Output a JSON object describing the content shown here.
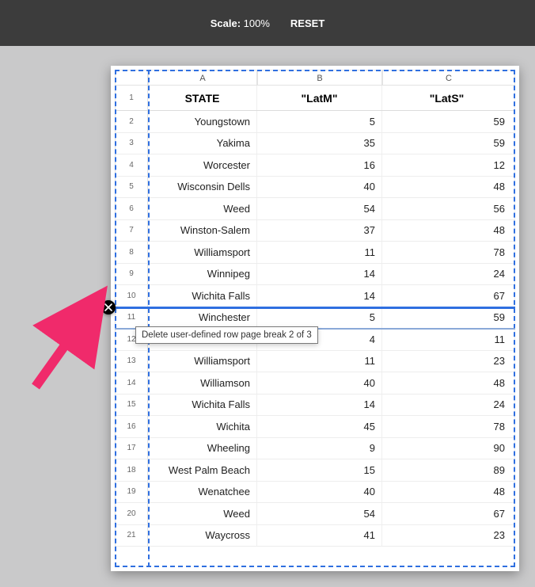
{
  "toolbar": {
    "scale_label": "Scale:",
    "scale_value": "100%",
    "reset": "RESET"
  },
  "columns": {
    "A": "A",
    "B": "B",
    "C": "C"
  },
  "header": {
    "state": "STATE",
    "latm": "\"LatM\"",
    "lats": "\"LatS\""
  },
  "rows": [
    {
      "n": "1"
    },
    {
      "n": "2",
      "state": "Youngstown",
      "latm": "5",
      "lats": "59"
    },
    {
      "n": "3",
      "state": "Yakima",
      "latm": "35",
      "lats": "59"
    },
    {
      "n": "4",
      "state": "Worcester",
      "latm": "16",
      "lats": "12"
    },
    {
      "n": "5",
      "state": "Wisconsin Dells",
      "latm": "40",
      "lats": "48"
    },
    {
      "n": "6",
      "state": "Weed",
      "latm": "54",
      "lats": "56"
    },
    {
      "n": "7",
      "state": "Winston-Salem",
      "latm": "37",
      "lats": "48"
    },
    {
      "n": "8",
      "state": "Williamsport",
      "latm": "11",
      "lats": "78"
    },
    {
      "n": "9",
      "state": "Winnipeg",
      "latm": "14",
      "lats": "24"
    },
    {
      "n": "10",
      "state": "Wichita Falls",
      "latm": "14",
      "lats": "67"
    },
    {
      "n": "11",
      "state": "Winchester",
      "latm": "5",
      "lats": "59"
    },
    {
      "n": "12",
      "state": "",
      "latm": "4",
      "lats": "11"
    },
    {
      "n": "13",
      "state": "Williamsport",
      "latm": "11",
      "lats": "23"
    },
    {
      "n": "14",
      "state": "Williamson",
      "latm": "40",
      "lats": "48"
    },
    {
      "n": "15",
      "state": "Wichita Falls",
      "latm": "14",
      "lats": "24"
    },
    {
      "n": "16",
      "state": "Wichita",
      "latm": "45",
      "lats": "78"
    },
    {
      "n": "17",
      "state": "Wheeling",
      "latm": "9",
      "lats": "90"
    },
    {
      "n": "18",
      "state": "West Palm Beach",
      "latm": "15",
      "lats": "89"
    },
    {
      "n": "19",
      "state": "Wenatchee",
      "latm": "40",
      "lats": "48"
    },
    {
      "n": "20",
      "state": "Weed",
      "latm": "54",
      "lats": "67"
    },
    {
      "n": "21",
      "state": "Waycross",
      "latm": "41",
      "lats": "23"
    }
  ],
  "tooltip": {
    "text": "Delete user-defined row page break 2 of 3"
  },
  "icons": {
    "break_handle": "close-icon"
  },
  "colors": {
    "accent": "#2f6fe0",
    "arrow": "#f02a6b"
  }
}
